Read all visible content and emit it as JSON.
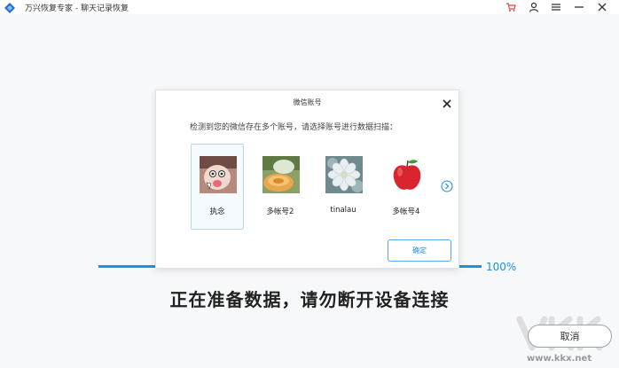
{
  "app": {
    "title": "万兴恢复专家 - 聊天记录恢复",
    "accent_color": "#1e8fe1",
    "toolbar_icons": [
      "cart-icon",
      "user-icon",
      "menu-icon",
      "minimize-icon",
      "close-icon"
    ]
  },
  "progress": {
    "value": 1.0,
    "label": "100%"
  },
  "status": {
    "text": "正在准备数据，请勿断开设备连接"
  },
  "cancel": {
    "label": "取消"
  },
  "watermark": {
    "url": "www.kkx.net"
  },
  "dialog": {
    "title": "微信账号",
    "message": "检测到您的微信存在多个账号，请选择账号进行数据扫描：",
    "accounts": [
      {
        "name": "执念",
        "selected": true,
        "avatar": "meme-avatar"
      },
      {
        "name": "多帐号2",
        "selected": false,
        "avatar": "melon-avatar"
      },
      {
        "name": "tinalau",
        "selected": false,
        "avatar": "flower-avatar"
      },
      {
        "name": "多帐号4",
        "selected": false,
        "avatar": "apple-avatar"
      }
    ],
    "confirm_label": "确定",
    "next_icon": "chevron-right-circle-icon"
  }
}
